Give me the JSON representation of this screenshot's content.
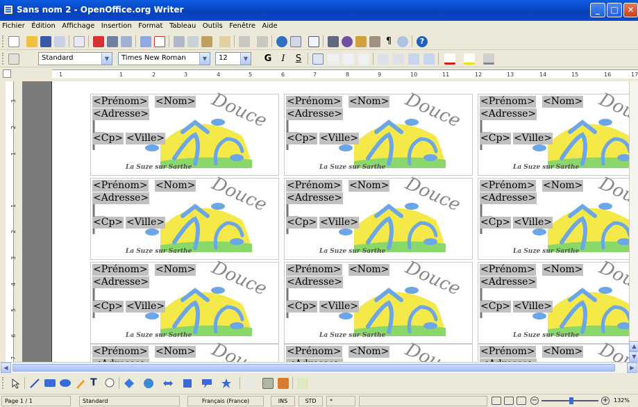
{
  "window": {
    "title": "Sans nom 2 - OpenOffice.org Writer"
  },
  "menu": [
    "Fichier",
    "Édition",
    "Affichage",
    "Insertion",
    "Format",
    "Tableau",
    "Outils",
    "Fenêtre",
    "Aide"
  ],
  "format": {
    "style": "Standard",
    "font": "Times New Roman",
    "size": "12",
    "bold": "G",
    "italic": "I",
    "underline": "S"
  },
  "ruler": {
    "ticks": [
      "1",
      "2",
      "1",
      "2",
      "3",
      "4",
      "5",
      "6",
      "7",
      "8",
      "9",
      "10",
      "11",
      "12",
      "13",
      "14",
      "15",
      "16",
      "17"
    ]
  },
  "vruler": {
    "nums": [
      "3",
      "2",
      "1",
      "1",
      "2",
      "3",
      "4",
      "5",
      "6",
      "7"
    ]
  },
  "label": {
    "prenom": "<Prénom>",
    "nom": "<Nom>",
    "adresse": "<Adresse>",
    "cp": "<Cp>",
    "ville": "<Ville>",
    "logo_text": "Douce",
    "town": "La Suze sur Sarthe"
  },
  "status": {
    "page": "Page 1 / 1",
    "style": "Standard",
    "language": "Français (France)",
    "ins": "INS",
    "std": "STD",
    "modified": "*",
    "zoom": "132%"
  },
  "colors": {
    "title_bar": "#0a4ad0",
    "field_bg": "#c0c0c0",
    "sun_yellow": "#f5e94a",
    "grass_green": "#8ad86a",
    "figure_blue": "#6aa6e8"
  }
}
